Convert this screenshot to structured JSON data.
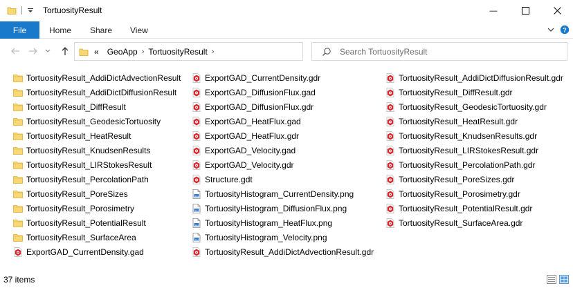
{
  "window": {
    "title": "TortuosityResult",
    "minimize_glyph": "—",
    "maximize_glyph": "☐",
    "close_glyph": "✕"
  },
  "ribbon": {
    "tabs": [
      "File",
      "Home",
      "Share",
      "View"
    ],
    "accent_color": "#1979ca"
  },
  "address": {
    "overflow": "«",
    "crumbs": [
      "GeoApp",
      "TortuosityResult"
    ],
    "separator": "›"
  },
  "search": {
    "placeholder": "Search TortuosityResult"
  },
  "icons": {
    "folder": "folder-icon",
    "data_file": "red-hexagon-file-icon",
    "text_file": "text-file-icon",
    "image_file": "png-image-file-icon"
  },
  "columns": [
    [
      {
        "name": "TortuosityResult_AddiDictAdvectionResult",
        "type": "folder"
      },
      {
        "name": "TortuosityResult_AddiDictDiffusionResult",
        "type": "folder"
      },
      {
        "name": "TortuosityResult_DiffResult",
        "type": "folder"
      },
      {
        "name": "TortuosityResult_GeodesicTortuosity",
        "type": "folder"
      },
      {
        "name": "TortuosityResult_HeatResult",
        "type": "folder"
      },
      {
        "name": "TortuosityResult_KnudsenResults",
        "type": "folder"
      },
      {
        "name": "TortuosityResult_LIRStokesResult",
        "type": "folder"
      },
      {
        "name": "TortuosityResult_PercolationPath",
        "type": "folder"
      },
      {
        "name": "TortuosityResult_PoreSizes",
        "type": "folder"
      },
      {
        "name": "TortuosityResult_Porosimetry",
        "type": "folder"
      },
      {
        "name": "TortuosityResult_PotentialResult",
        "type": "folder"
      },
      {
        "name": "TortuosityResult_SurfaceArea",
        "type": "folder"
      },
      {
        "name": "ExportGAD_CurrentDensity.gad",
        "type": "data"
      }
    ],
    [
      {
        "name": "ExportGAD_CurrentDensity.gdr",
        "type": "data"
      },
      {
        "name": "ExportGAD_DiffusionFlux.gad",
        "type": "data"
      },
      {
        "name": "ExportGAD_DiffusionFlux.gdr",
        "type": "data"
      },
      {
        "name": "ExportGAD_HeatFlux.gad",
        "type": "data"
      },
      {
        "name": "ExportGAD_HeatFlux.gdr",
        "type": "data"
      },
      {
        "name": "ExportGAD_Velocity.gad",
        "type": "data"
      },
      {
        "name": "ExportGAD_Velocity.gdr",
        "type": "data"
      },
      {
        "name": "Structure.gdt",
        "type": "data"
      },
      {
        "name": "TortuosityHistogram_CurrentDensity.png",
        "type": "image"
      },
      {
        "name": "TortuosityHistogram_DiffusionFlux.png",
        "type": "image"
      },
      {
        "name": "TortuosityHistogram_HeatFlux.png",
        "type": "image"
      },
      {
        "name": "TortuosityHistogram_Velocity.png",
        "type": "image"
      },
      {
        "name": "TortuosityResult_AddiDictAdvectionResult.gdr",
        "type": "data"
      }
    ],
    [
      {
        "name": "TortuosityResult_AddiDictDiffusionResult.gdr",
        "type": "data"
      },
      {
        "name": "TortuosityResult_DiffResult.gdr",
        "type": "data"
      },
      {
        "name": "TortuosityResult_GeodesicTortuosity.gdr",
        "type": "data"
      },
      {
        "name": "TortuosityResult_HeatResult.gdr",
        "type": "data"
      },
      {
        "name": "TortuosityResult_KnudsenResults.gdr",
        "type": "data"
      },
      {
        "name": "TortuosityResult_LIRStokesResult.gdr",
        "type": "data"
      },
      {
        "name": "TortuosityResult_PercolationPath.gdr",
        "type": "data"
      },
      {
        "name": "TortuosityResult_PoreSizes.gdr",
        "type": "data"
      },
      {
        "name": "TortuosityResult_Porosimetry.gdr",
        "type": "data"
      },
      {
        "name": "TortuosityResult_PotentialResult.gdr",
        "type": "data"
      },
      {
        "name": "TortuosityResult_SurfaceArea.gdr",
        "type": "data"
      }
    ]
  ],
  "status": {
    "item_count": "37 items"
  }
}
